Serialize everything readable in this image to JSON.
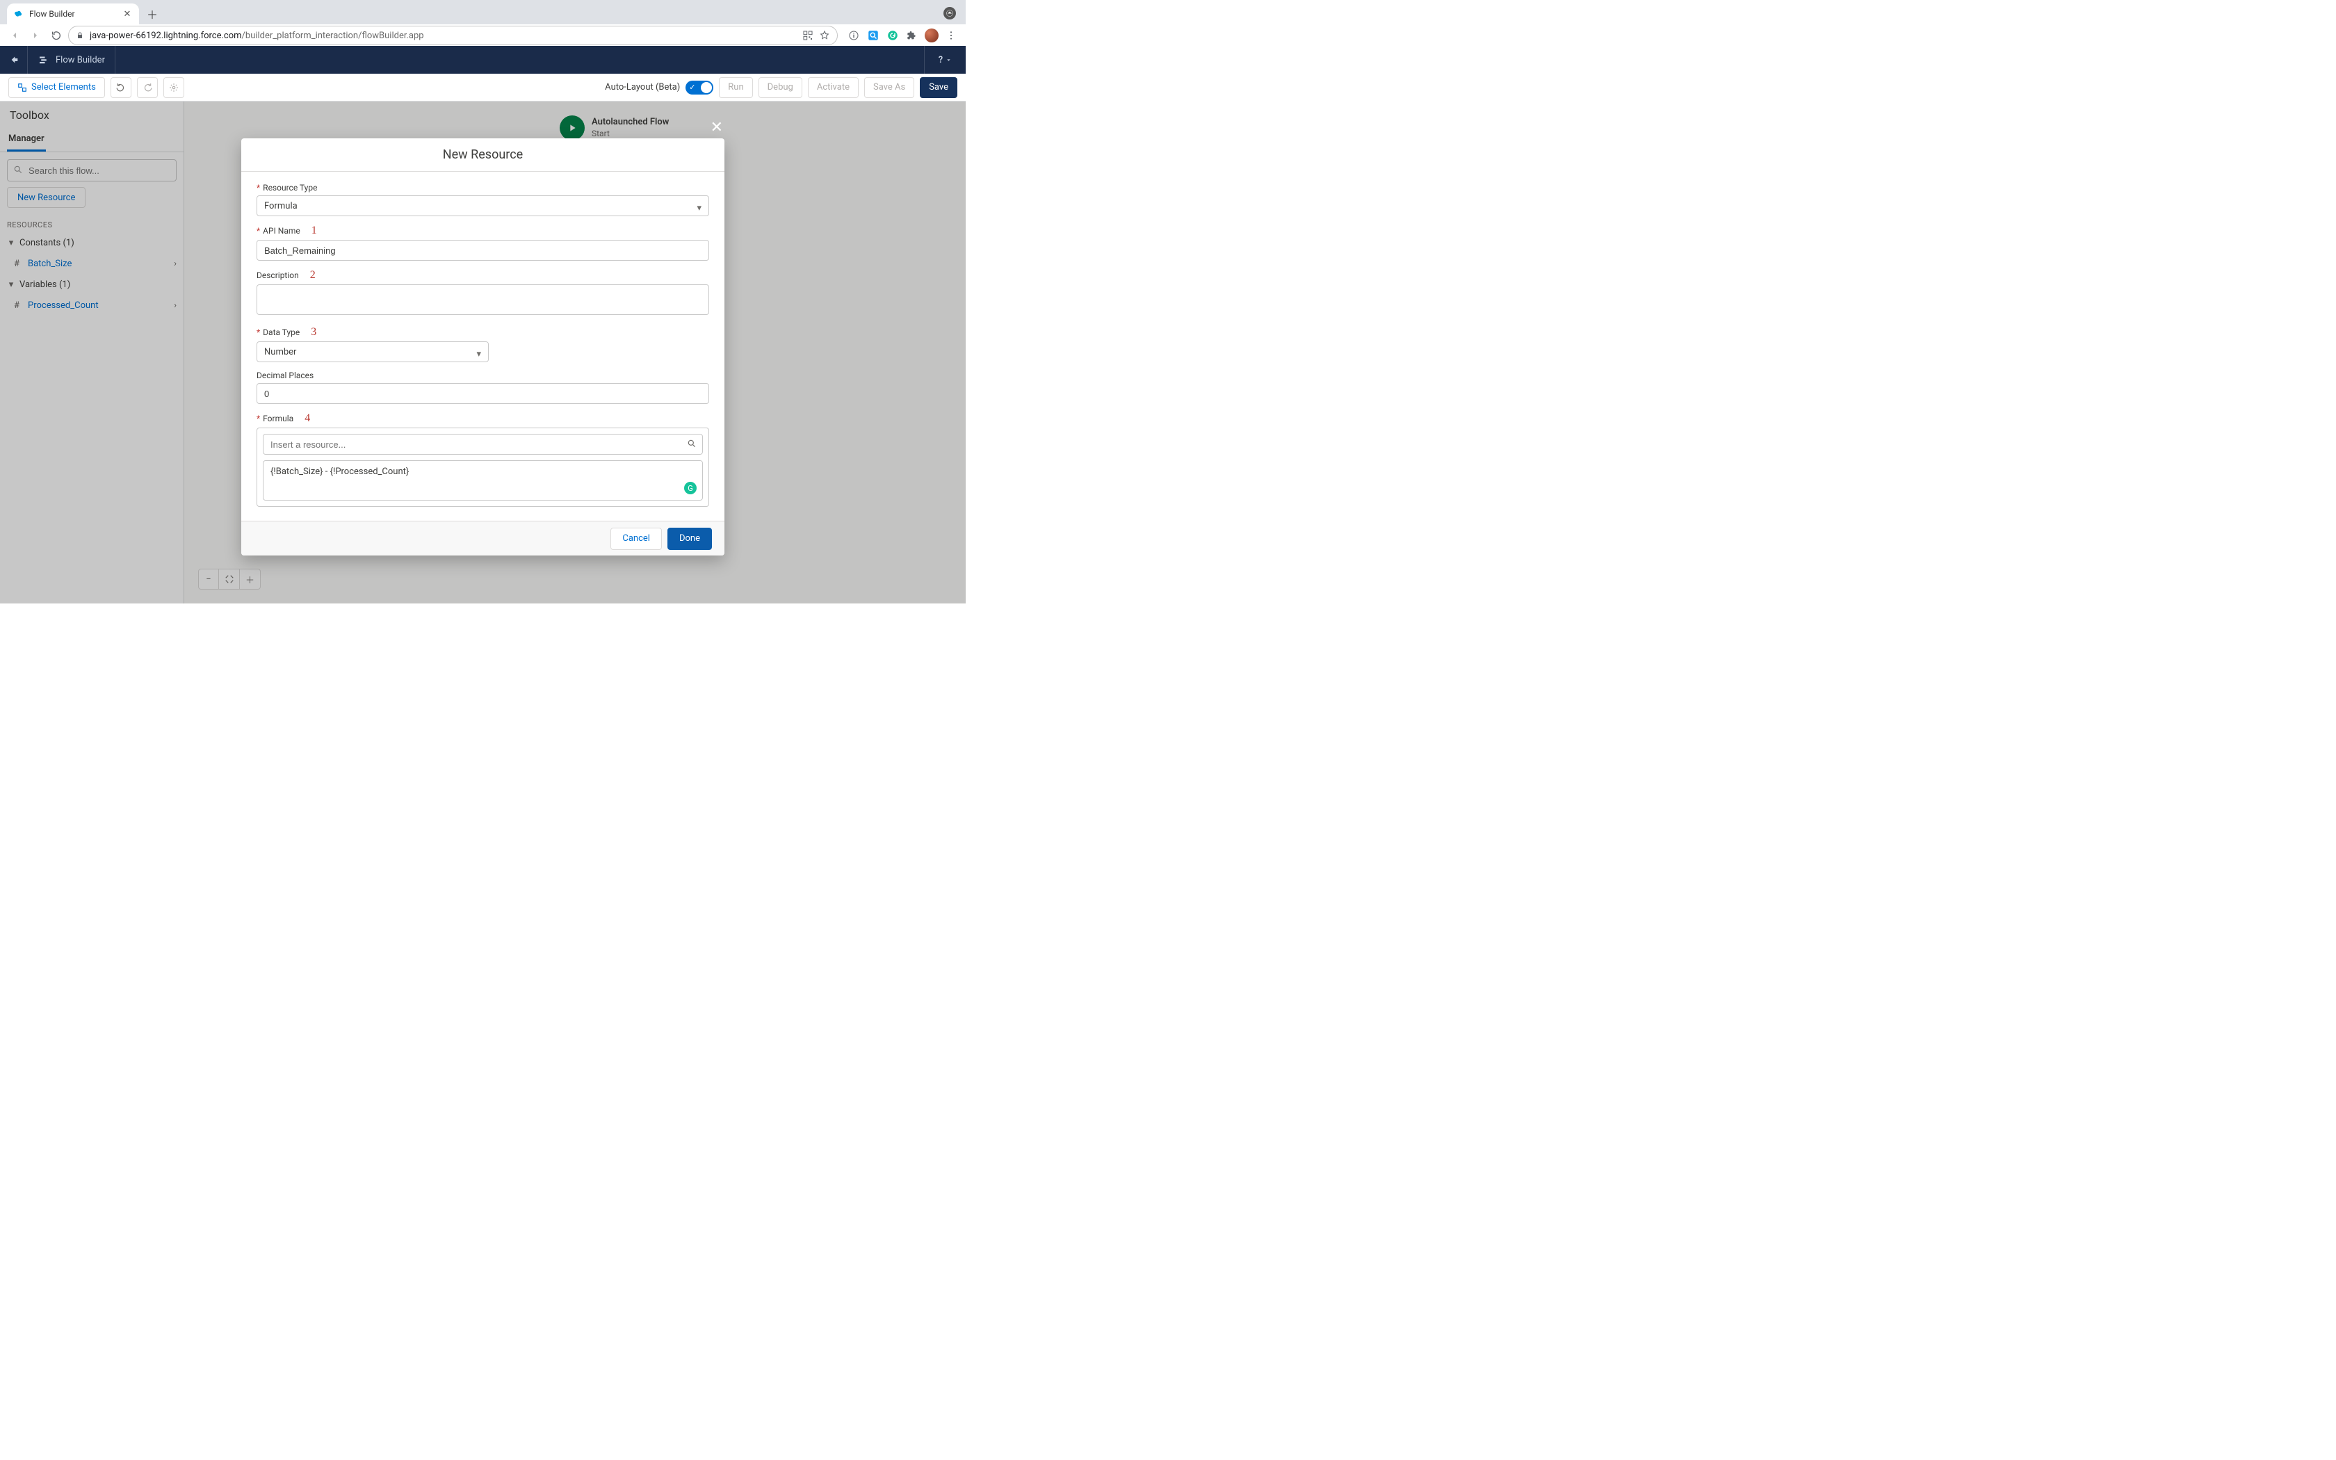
{
  "browser": {
    "tab_title": "Flow Builder",
    "url_host": "java-power-66192.lightning.force.com",
    "url_path": "/builder_platform_interaction/flowBuilder.app"
  },
  "app_header": {
    "back_aria": "Back",
    "title": "Flow Builder",
    "help": "?"
  },
  "toolbar": {
    "select_elements": "Select Elements",
    "undo_aria": "Undo",
    "redo_aria": "Redo",
    "settings_aria": "Settings",
    "auto_layout_label": "Auto-Layout (Beta)",
    "run": "Run",
    "debug": "Debug",
    "activate": "Activate",
    "save_as": "Save As",
    "save": "Save"
  },
  "sidebar": {
    "title": "Toolbox",
    "tabs": {
      "manager": "Manager"
    },
    "search_placeholder": "Search this flow...",
    "new_resource": "New Resource",
    "section_resources": "RESOURCES",
    "groups": [
      {
        "label": "Constants (1)",
        "items": [
          {
            "name": "Batch_Size"
          }
        ]
      },
      {
        "label": "Variables (1)",
        "items": [
          {
            "name": "Processed_Count"
          }
        ]
      }
    ]
  },
  "canvas": {
    "start_title": "Autolaunched Flow",
    "start_sub": "Start",
    "zoom_out_aria": "Zoom out",
    "zoom_fit_aria": "Fit to screen",
    "zoom_in_aria": "Zoom in"
  },
  "modal": {
    "title": "New Resource",
    "close_aria": "Close",
    "fields": {
      "resource_type_label": "Resource Type",
      "resource_type_value": "Formula",
      "api_name_label": "API Name",
      "api_name_value": "Batch_Remaining",
      "description_label": "Description",
      "description_value": "",
      "data_type_label": "Data Type",
      "data_type_value": "Number",
      "decimal_label": "Decimal Places",
      "decimal_value": "0",
      "formula_label": "Formula",
      "formula_search_placeholder": "Insert a resource...",
      "formula_value": "{!Batch_Size} - {!Processed_Count}"
    },
    "annotations": {
      "one": "1",
      "two": "2",
      "three": "3",
      "four": "4"
    },
    "buttons": {
      "cancel": "Cancel",
      "done": "Done"
    }
  }
}
